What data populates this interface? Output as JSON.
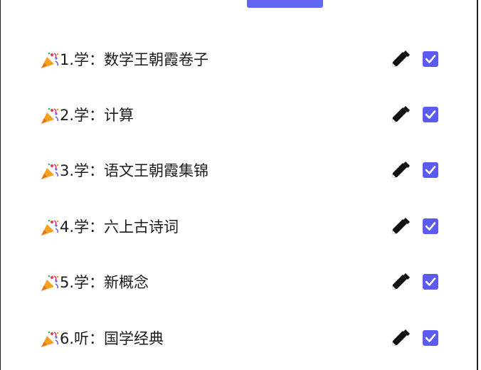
{
  "tasks": [
    {
      "label": "1.学：数学王朝霞卷子",
      "done": true,
      "icon": "party-popper-icon"
    },
    {
      "label": "2.学：计算",
      "done": true,
      "icon": "party-popper-icon"
    },
    {
      "label": "3.学：语文王朝霞集锦",
      "done": true,
      "icon": "party-popper-icon"
    },
    {
      "label": "4.学：六上古诗词",
      "done": true,
      "icon": "party-popper-icon"
    },
    {
      "label": "5.学：新概念",
      "done": true,
      "icon": "party-popper-icon"
    },
    {
      "label": "6.听：国学经典",
      "done": true,
      "icon": "party-popper-icon"
    }
  ],
  "colors": {
    "accent": "#5b5bf0",
    "text": "#1a1a1a",
    "border": "#1e1e1e"
  }
}
